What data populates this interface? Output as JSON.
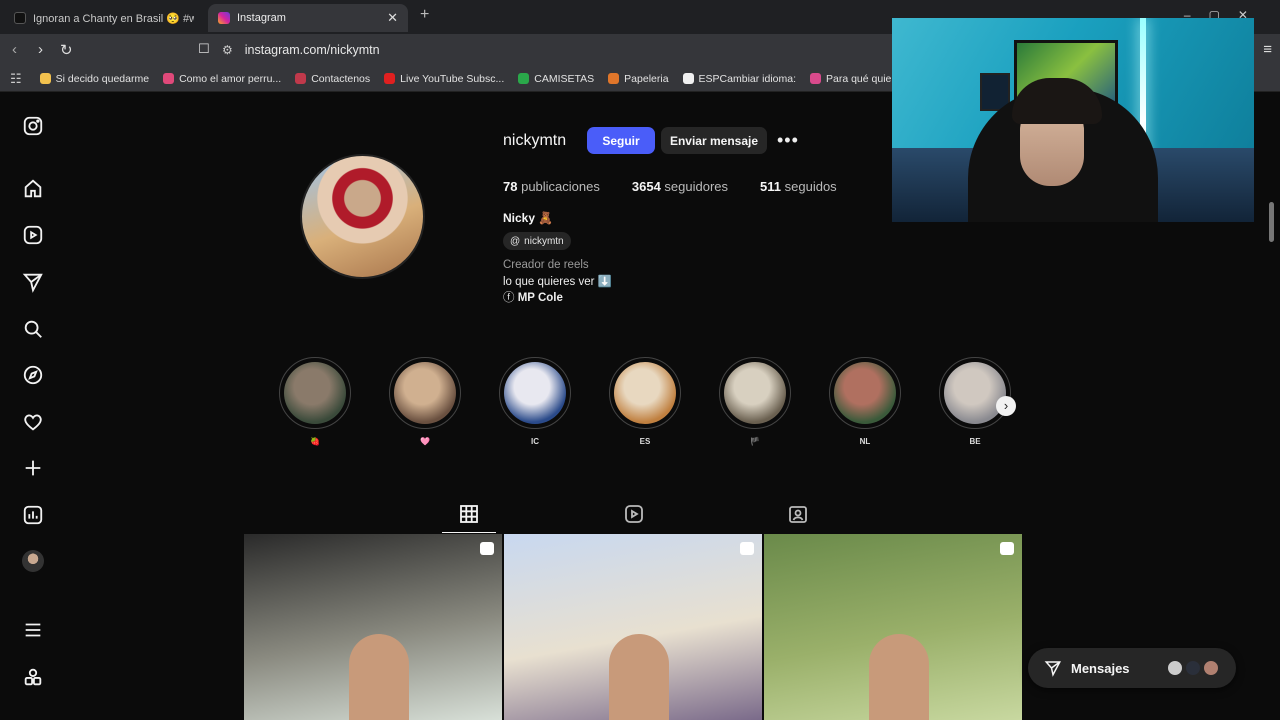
{
  "browser": {
    "tabs": [
      {
        "label": "Ignoran a Chanty en Brasil 🥺 #west",
        "favicon_color": "#111111",
        "active": false
      },
      {
        "label": "Instagram",
        "favicon_color": "#d6249f",
        "active": true
      }
    ],
    "new_tab": "+",
    "close_tab": "✕",
    "url": "instagram.com/nickymtn",
    "bookmarks": [
      {
        "label": "Si decido quedarme",
        "color": "#f2c14e"
      },
      {
        "label": "Como el amor perru...",
        "color": "#e0497a"
      },
      {
        "label": "Contactenos",
        "color": "#c0394b"
      },
      {
        "label": "Live YouTube Subsc...",
        "color": "#e02020"
      },
      {
        "label": "CAMISETAS",
        "color": "#2aa84a"
      },
      {
        "label": "Papeleria",
        "color": "#e0762a"
      },
      {
        "label": "ESPCambiar idioma:",
        "color": "#f0f0f0"
      },
      {
        "label": "Para qué quiero asp",
        "color": "#d94a8c"
      }
    ]
  },
  "profile": {
    "username": "nickymtn",
    "follow_label": "Seguir",
    "message_label": "Enviar mensaje",
    "more_label": "•••",
    "posts_count": "78",
    "posts_label": "publicaciones",
    "followers_count": "3654",
    "followers_label": "seguidores",
    "following_count": "511",
    "following_label": "seguidos",
    "full_name": "Nicky 🧸",
    "threads_handle": "nickymtn",
    "bio_category": "Creador de reels",
    "bio_line": "lo que quieres ver ⬇️",
    "bio_link": "MP Cole"
  },
  "highlights": [
    {
      "label": "🍓",
      "colors": [
        "#3a4a3a",
        "#8a7a6a"
      ]
    },
    {
      "label": "🩷",
      "colors": [
        "#6a5040",
        "#d0b090"
      ]
    },
    {
      "label": "IC",
      "colors": [
        "#2a4a8a",
        "#e8e8f0"
      ]
    },
    {
      "label": "ES",
      "colors": [
        "#c08040",
        "#e8d8c0"
      ]
    },
    {
      "label": "🏴",
      "colors": [
        "#6a6050",
        "#d8d0c0"
      ]
    },
    {
      "label": "NL",
      "colors": [
        "#3a5a3a",
        "#b07060"
      ]
    },
    {
      "label": "BE",
      "colors": [
        "#8a8a90",
        "#d0c8c0"
      ]
    }
  ],
  "posts": [
    {
      "type": "reel",
      "colors": [
        "#2a2a2a",
        "#8a8a80",
        "#d8e0d8"
      ]
    },
    {
      "type": "reel",
      "colors": [
        "#c8d8f0",
        "#e8e0d0",
        "#7a6a8a"
      ]
    },
    {
      "type": "carousel",
      "colors": [
        "#6a8a4a",
        "#9ab06a",
        "#c8d8a0"
      ]
    }
  ],
  "messages": {
    "label": "Mensajes"
  },
  "sidenav": [
    "instagram-logo",
    "home",
    "reels",
    "direct",
    "search",
    "explore",
    "notifications",
    "create",
    "dashboard",
    "profile",
    "more",
    "threads"
  ]
}
